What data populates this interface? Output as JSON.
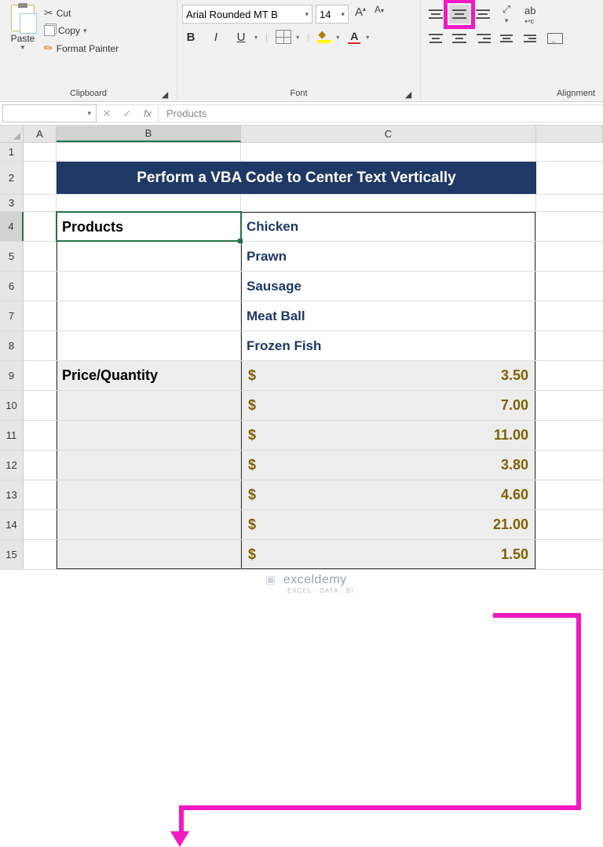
{
  "ribbon": {
    "clipboard": {
      "paste": "Paste",
      "cut": "Cut",
      "copy": "Copy",
      "format_painter": "Format Painter",
      "group_label": "Clipboard"
    },
    "font": {
      "name": "Arial Rounded MT B",
      "size": "14",
      "group_label": "Font"
    },
    "alignment": {
      "group_label": "Alignment"
    }
  },
  "formula_bar": {
    "value": "Products"
  },
  "columns": {
    "A": "A",
    "B": "B",
    "C": "C",
    "D": ""
  },
  "row_numbers": [
    "1",
    "2",
    "3",
    "4",
    "5",
    "6",
    "7",
    "8",
    "9",
    "10",
    "11",
    "12",
    "13",
    "14",
    "15"
  ],
  "banner": "Perform a VBA Code to Center Text Vertically",
  "table": {
    "products_header": "Products",
    "products": [
      "Chicken",
      "Prawn",
      "Sausage",
      "Meat Ball",
      "Frozen Fish"
    ],
    "price_header": "Price/Quantity",
    "currency": "$",
    "prices": [
      "3.50",
      "7.00",
      "11.00",
      "3.80",
      "4.60",
      "21.00",
      "1.50"
    ]
  },
  "watermark": {
    "brand": "exceldemy",
    "tag": "EXCEL · DATA · BI"
  }
}
